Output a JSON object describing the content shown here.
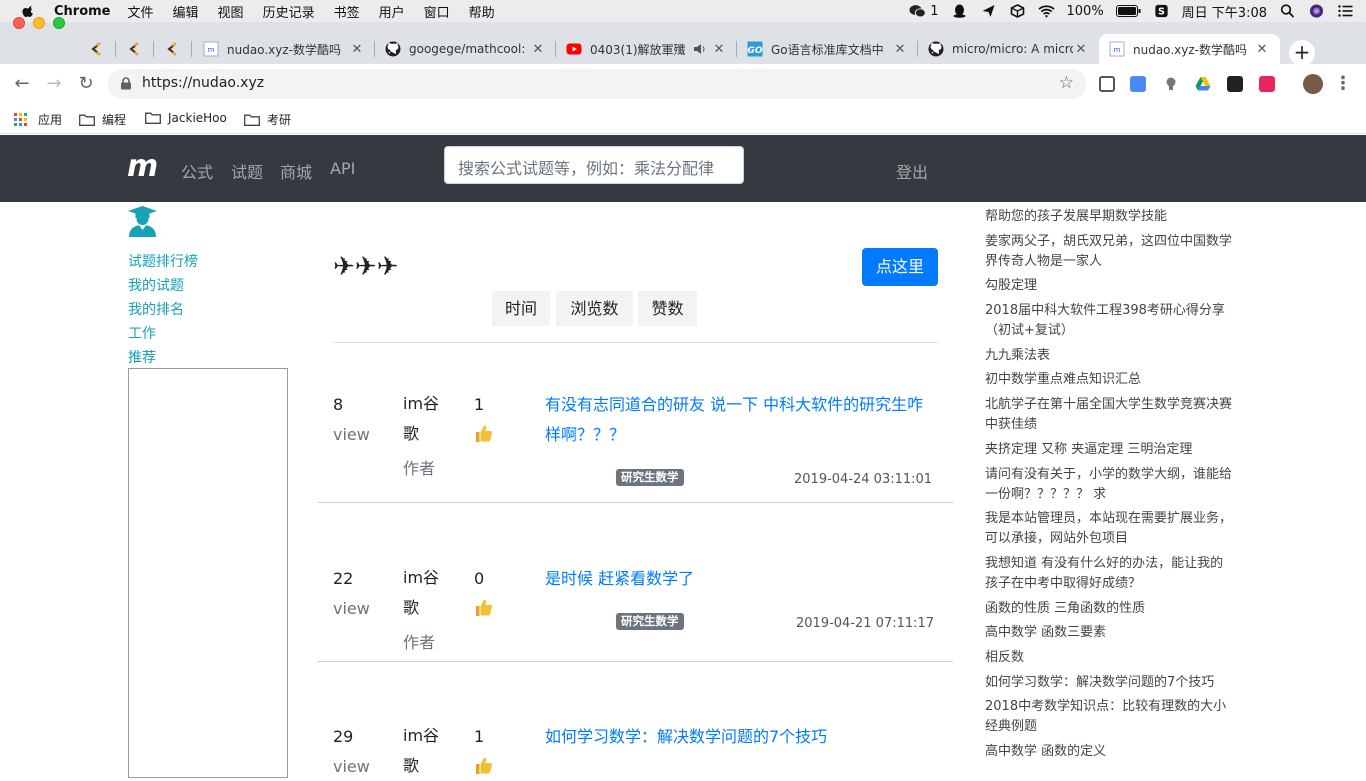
{
  "menubar": {
    "app": "Chrome",
    "items": [
      "文件",
      "编辑",
      "视图",
      "历史记录",
      "书签",
      "用户",
      "窗口",
      "帮助"
    ],
    "wechat_count": "1",
    "battery": "100%",
    "clock": "周日 下午3:08"
  },
  "tabs": [
    {
      "title": ""
    },
    {
      "title": ""
    },
    {
      "title": ""
    },
    {
      "title": "nudao.xyz-数学酷吗"
    },
    {
      "title": "googege/mathcool: "
    },
    {
      "title": "0403(1)解放軍殲"
    },
    {
      "title": "Go语言标准库文档中"
    },
    {
      "title": "micro/micro: A micro"
    },
    {
      "title": "nudao.xyz-数学酷吗"
    }
  ],
  "toolbar": {
    "url": "https://nudao.xyz"
  },
  "bookmarks": [
    "应用",
    "编程",
    "JackieHoo",
    "考研"
  ],
  "site": {
    "logo": "m",
    "nav": [
      "公式",
      "试题",
      "商城",
      "API"
    ],
    "search_placeholder": "搜索公式试题等，例如：乘法分配律",
    "logout": "登出"
  },
  "sidebar": {
    "links": [
      "试题排行榜",
      "我的试题",
      "我的排名",
      "工作",
      "推荐"
    ]
  },
  "main": {
    "planes": "✈✈✈",
    "button": "点这里",
    "sort": [
      "时间",
      "浏览数",
      "赞数"
    ],
    "view_label": "view",
    "author_label": "作者",
    "thumb_icon": "thumbs-up-icon",
    "questions": [
      {
        "views": "8",
        "author": "im谷歌",
        "likes": "1",
        "title": "有没有志同道合的研友 说一下 中科大软件的研究生咋样啊？？？",
        "tag": "研究生数学",
        "date": "2019-04-24 03:11:01"
      },
      {
        "views": "22",
        "author": "im谷歌",
        "likes": "0",
        "title": "是时候 赶紧看数学了",
        "tag": "研究生数学",
        "date": "2019-04-21 07:11:17"
      },
      {
        "views": "29",
        "author": "im谷歌",
        "likes": "1",
        "title": "如何学习数学：解决数学问题的7个技巧",
        "tag": "",
        "date": ""
      }
    ]
  },
  "right_links": [
    "帮助您的孩子发展早期数学技能",
    "姜家两父子，胡氏双兄弟，这四位中国数学界传奇人物是一家人",
    "勾股定理",
    "2018届中科大软件工程398考研心得分享（初试+复试）",
    "九九乘法表",
    "初中数学重点难点知识汇总",
    "北航学子在第十届全国大学生数学竞赛决赛中获佳绩",
    "夹挤定理 又称 夹逼定理 三明治定理",
    "请问有没有关于，小学的数学大纲，谁能给一份啊？？？？？ 求",
    "我是本站管理员，本站现在需要扩展业务，可以承接，网站外包项目",
    "我想知道 有没有什么好的办法，能让我的孩子在中考中取得好成绩？",
    "函数的性质 三角函数的性质",
    "高中数学 函数三要素",
    "相反数",
    "如何学习数学：解决数学问题的7个技巧",
    "2018中考数学知识点：比较有理数的大小 经典例题",
    "高中数学 函数的定义"
  ],
  "colors": {
    "navbar": "#343a40",
    "link": "#007bff",
    "teal": "#17a2b8",
    "badge": "#6c757d"
  }
}
